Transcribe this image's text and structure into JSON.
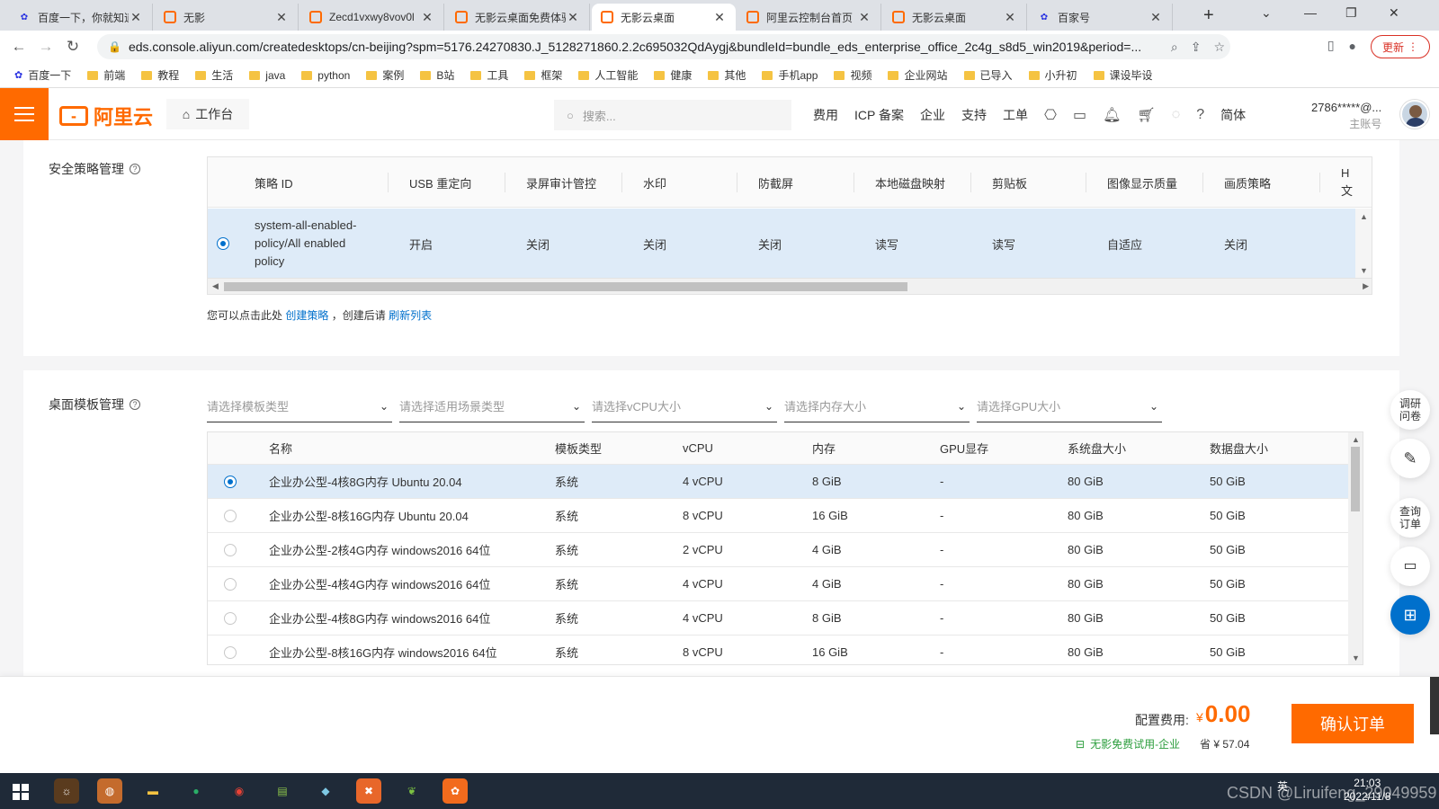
{
  "browser": {
    "tabs": [
      {
        "label": "百度一下，你就知道",
        "icon": "baidu",
        "active": false
      },
      {
        "label": "无影",
        "icon": "aliyun",
        "active": false
      },
      {
        "label": "Zecd1vxwy8vov0l",
        "icon": "aliyun",
        "active": false
      },
      {
        "label": "无影云桌面免费体验",
        "icon": "aliyun",
        "active": false
      },
      {
        "label": "无影云桌面",
        "icon": "aliyun",
        "active": true
      },
      {
        "label": "阿里云控制台首页",
        "icon": "aliyun",
        "active": false
      },
      {
        "label": "无影云桌面",
        "icon": "aliyun",
        "active": false
      },
      {
        "label": "百家号",
        "icon": "baidu",
        "active": false
      }
    ],
    "url": "eds.console.aliyun.com/createdesktops/cn-beijing?spm=5176.24270830.J_5128271860.2.2c695032QdAygj&bundleId=bundle_eds_enterprise_office_2c4g_s8d5_win2019&period=...",
    "update_label": "更新",
    "bookmarks": [
      {
        "label": "百度一下",
        "icon": "baidu"
      },
      {
        "label": "前端",
        "icon": "folder"
      },
      {
        "label": "教程",
        "icon": "folder"
      },
      {
        "label": "生活",
        "icon": "folder"
      },
      {
        "label": "java",
        "icon": "folder"
      },
      {
        "label": "python",
        "icon": "folder"
      },
      {
        "label": "案例",
        "icon": "folder"
      },
      {
        "label": "B站",
        "icon": "folder"
      },
      {
        "label": "工具",
        "icon": "folder"
      },
      {
        "label": "框架",
        "icon": "folder"
      },
      {
        "label": "人工智能",
        "icon": "folder"
      },
      {
        "label": "健康",
        "icon": "folder"
      },
      {
        "label": "其他",
        "icon": "folder"
      },
      {
        "label": "手机app",
        "icon": "folder"
      },
      {
        "label": "视频",
        "icon": "folder"
      },
      {
        "label": "企业网站",
        "icon": "folder"
      },
      {
        "label": "已导入",
        "icon": "folder"
      },
      {
        "label": "小升初",
        "icon": "folder"
      },
      {
        "label": "课设毕设",
        "icon": "folder"
      }
    ]
  },
  "header": {
    "brand": "阿里云",
    "workbench": "工作台",
    "search_placeholder": "搜索...",
    "nav": [
      "费用",
      "ICP 备案",
      "企业",
      "支持",
      "工单"
    ],
    "lang": "简体",
    "account": "2786*****@...",
    "account_role": "主账号",
    "accent": "#ff6a00"
  },
  "policy": {
    "section_label": "安全策略管理",
    "columns": [
      "策略 ID",
      "USB 重定向",
      "录屏审计管控",
      "水印",
      "防截屏",
      "本地磁盘映射",
      "剪贴板",
      "图像显示质量",
      "画质策略",
      "H 文"
    ],
    "row": {
      "id": "system-all-enabled-policy/All enabled policy",
      "id_lines": [
        "system-all-enabled-",
        "policy/All enabled",
        "policy"
      ],
      "values": [
        "开启",
        "关闭",
        "关闭",
        "关闭",
        "读写",
        "读写",
        "自适应",
        "关闭"
      ],
      "selected": true
    },
    "hint_prefix": "您可以点击此处",
    "hint_link1": "创建策略",
    "hint_middle": "，创建后请",
    "hint_link2": "刷新列表"
  },
  "templates": {
    "section_label": "桌面模板管理",
    "filters": [
      "请选择模板类型",
      "请选择适用场景类型",
      "请选择vCPU大小",
      "请选择内存大小",
      "请选择GPU大小"
    ],
    "columns": [
      "名称",
      "模板类型",
      "vCPU",
      "内存",
      "GPU显存",
      "系统盘大小",
      "数据盘大小"
    ],
    "rows": [
      {
        "name": "企业办公型-4核8G内存 Ubuntu 20.04",
        "type": "系统",
        "vcpu": "4 vCPU",
        "mem": "8 GiB",
        "gpu": "-",
        "sys": "80 GiB",
        "data": "50 GiB",
        "selected": true
      },
      {
        "name": "企业办公型-8核16G内存 Ubuntu 20.04",
        "type": "系统",
        "vcpu": "8 vCPU",
        "mem": "16 GiB",
        "gpu": "-",
        "sys": "80 GiB",
        "data": "50 GiB",
        "selected": false
      },
      {
        "name": "企业办公型-2核4G内存 windows2016 64位",
        "type": "系统",
        "vcpu": "2 vCPU",
        "mem": "4 GiB",
        "gpu": "-",
        "sys": "80 GiB",
        "data": "50 GiB",
        "selected": false
      },
      {
        "name": "企业办公型-4核4G内存 windows2016 64位",
        "type": "系统",
        "vcpu": "4 vCPU",
        "mem": "4 GiB",
        "gpu": "-",
        "sys": "80 GiB",
        "data": "50 GiB",
        "selected": false
      },
      {
        "name": "企业办公型-4核8G内存 windows2016 64位",
        "type": "系统",
        "vcpu": "4 vCPU",
        "mem": "8 GiB",
        "gpu": "-",
        "sys": "80 GiB",
        "data": "50 GiB",
        "selected": false
      },
      {
        "name": "企业办公型-8核16G内存 windows2016 64位",
        "type": "系统",
        "vcpu": "8 vCPU",
        "mem": "16 GiB",
        "gpu": "-",
        "sys": "80 GiB",
        "data": "50 GiB",
        "selected": false
      }
    ]
  },
  "floating": {
    "survey": "调研问卷",
    "orders": "查询订单"
  },
  "footer": {
    "fee_label": "配置费用:",
    "currency": "¥",
    "fee_value": "0.00",
    "trial_label": "无影免费试用-企业",
    "saved": "省 ¥ 57.04",
    "confirm_label": "确认订单"
  },
  "taskbar": {
    "tray_lang": "英",
    "time": "21:03",
    "date": "2022/11/8",
    "watermark": "CSDN @Liruifeng_29049959"
  }
}
